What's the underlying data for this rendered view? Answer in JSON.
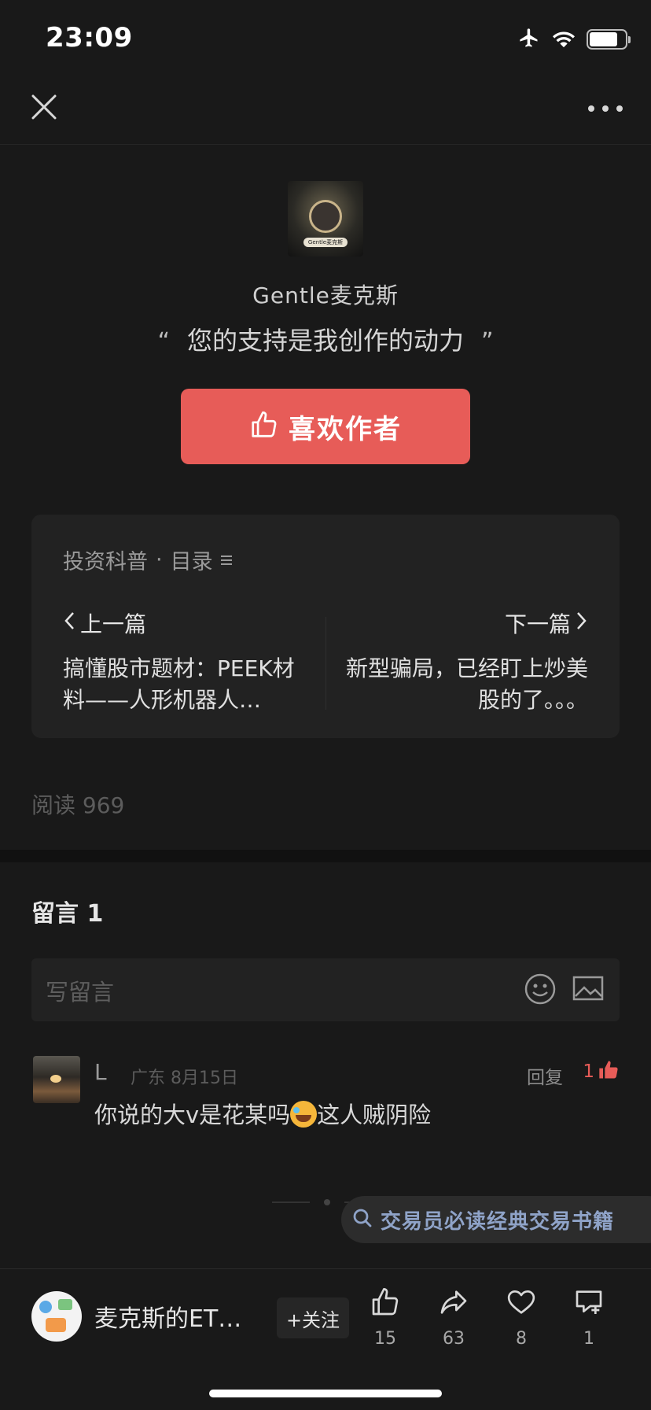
{
  "status_bar": {
    "time": "23:09",
    "battery_level": 0.8
  },
  "nav": {
    "close_icon": "close-icon",
    "more_icon": "more-icon"
  },
  "author": {
    "name": "Gentle麦克斯",
    "avatar_tag": "Gentle麦克斯",
    "motto": "您的支持是我创作的动力",
    "quote_open": "“",
    "quote_close": "”",
    "like_button": "喜欢作者"
  },
  "series": {
    "name": "投资科普",
    "separator": "·",
    "catalog": "目录",
    "prev_label": "上一篇",
    "prev_title": "搞懂股市题材：PEEK材料——人形机器人…",
    "next_label": "下一篇",
    "next_title": "新型骗局，已经盯上炒美股的了。。。"
  },
  "read_count": "阅读 969",
  "comments": {
    "title": "留言 1",
    "input_placeholder": "写留言",
    "items": [
      {
        "user": "L",
        "meta": "广东 8月15日",
        "reply": "回复",
        "likes": "1",
        "text_before": "你说的大v是花某吗",
        "text_after": "这人贼阴险"
      }
    ]
  },
  "search_pill": {
    "text": "交易员必读经典交易书籍"
  },
  "bottom_bar": {
    "account_name": "麦克斯的ET…",
    "follow": "+关注",
    "like_count": "15",
    "share_count": "63",
    "favorite_count": "8",
    "comment_count": "1"
  },
  "colors": {
    "accent": "#e75c58",
    "background": "#191919",
    "card": "#222222",
    "search_text": "#8fa3c8"
  }
}
